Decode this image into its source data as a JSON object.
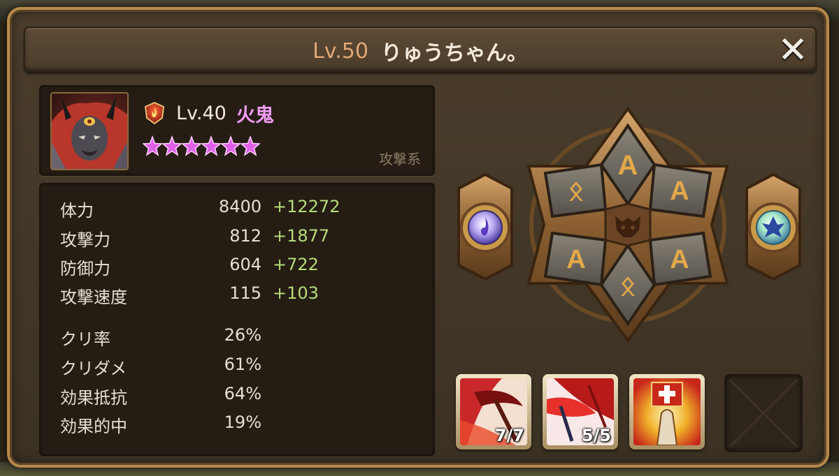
{
  "header": {
    "level": "Lv.50",
    "player_name": "りゅうちゃん。",
    "close_symbol": "✕"
  },
  "monster": {
    "element_icon": "fire-element-icon",
    "level": "Lv.40",
    "name": "火鬼",
    "stars": 6,
    "role": "攻撃系",
    "name_color": "#f09cf3"
  },
  "stats": {
    "main": [
      {
        "label": "体力",
        "value": "8400",
        "bonus": "+12272"
      },
      {
        "label": "攻撃力",
        "value": "812",
        "bonus": "+1877"
      },
      {
        "label": "防御力",
        "value": "604",
        "bonus": "+722"
      },
      {
        "label": "攻撃速度",
        "value": "115",
        "bonus": "+103"
      }
    ],
    "secondary": [
      {
        "label": "クリ率",
        "value": "26%"
      },
      {
        "label": "クリダメ",
        "value": "61%"
      },
      {
        "label": "効果抵抗",
        "value": "64%"
      },
      {
        "label": "効果的中",
        "value": "19%"
      }
    ],
    "bonus_color": "#b6dc78"
  },
  "runes": {
    "slots": [
      "A",
      "A",
      "A",
      "A",
      "ᛟ",
      "ᛟ"
    ],
    "center_icon": "demon-skull-icon",
    "left_artifact_icon": "purple-gem-artifact-icon",
    "right_artifact_icon": "fleur-gem-artifact-icon"
  },
  "skills": [
    {
      "icon": "red-scythe-skill-icon",
      "count": "7/7"
    },
    {
      "icon": "crimson-blade-skill-icon",
      "count": "5/5"
    },
    {
      "icon": "holy-shield-skill-icon",
      "count": ""
    }
  ]
}
